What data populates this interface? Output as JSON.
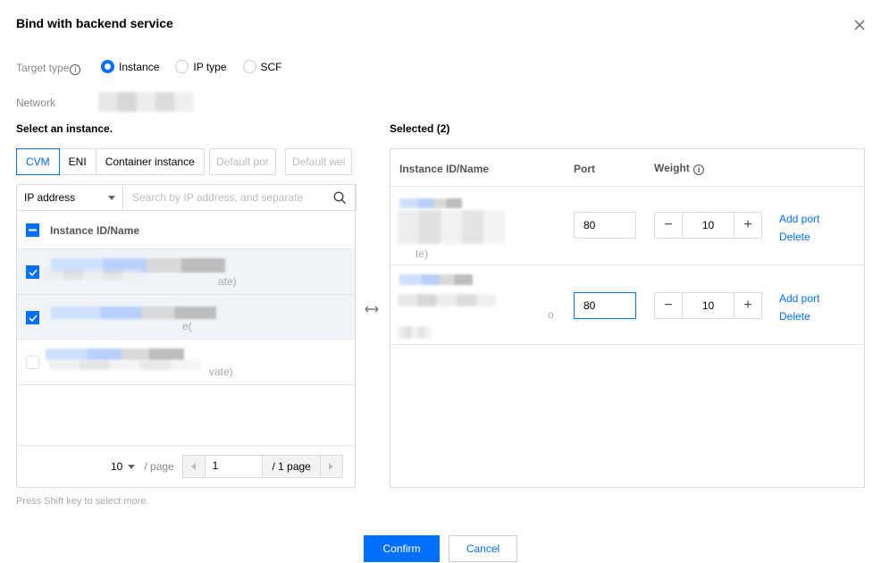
{
  "dialog": {
    "title": "Bind with backend service",
    "close_icon": "close-icon"
  },
  "target_type": {
    "label": "Target type",
    "options": [
      {
        "label": "Instance",
        "selected": true
      },
      {
        "label": "IP type",
        "selected": false
      },
      {
        "label": "SCF",
        "selected": false
      }
    ]
  },
  "network": {
    "label": "Network"
  },
  "select_panel": {
    "heading": "Select an instance.",
    "tabs": [
      {
        "label": "CVM",
        "active": true
      },
      {
        "label": "ENI",
        "active": false
      },
      {
        "label": "Container instance",
        "active": false
      }
    ],
    "default_port_placeholder": "Default por",
    "default_weight_placeholder": "Default wei",
    "filter_select": "IP address",
    "search_placeholder": "Search by IP address, and separate",
    "column_header": "Instance ID/Name",
    "rows": [
      {
        "checked": true,
        "suffix": "ate)"
      },
      {
        "checked": true,
        "suffix": "e("
      },
      {
        "checked": false,
        "suffix": "vate)"
      }
    ],
    "pager": {
      "page_size": "10",
      "per_page_label": "/ page",
      "current_page": "1",
      "total_label": "/ 1 page"
    },
    "hint": "Press Shift key to select more."
  },
  "selected_panel": {
    "heading": "Selected (2)",
    "columns": {
      "instance": "Instance ID/Name",
      "port": "Port",
      "weight": "Weight"
    },
    "rows": [
      {
        "port": "80",
        "weight": "10",
        "add_port": "Add port",
        "delete": "Delete",
        "suffix": "te)"
      },
      {
        "port": "80",
        "weight": "10",
        "add_port": "Add port",
        "delete": "Delete",
        "suffix": "o"
      }
    ]
  },
  "footer": {
    "confirm": "Confirm",
    "cancel": "Cancel"
  },
  "colors": {
    "accent": "#006eff",
    "border": "#dcdcdc",
    "selected_row": "#f0f3f8"
  }
}
